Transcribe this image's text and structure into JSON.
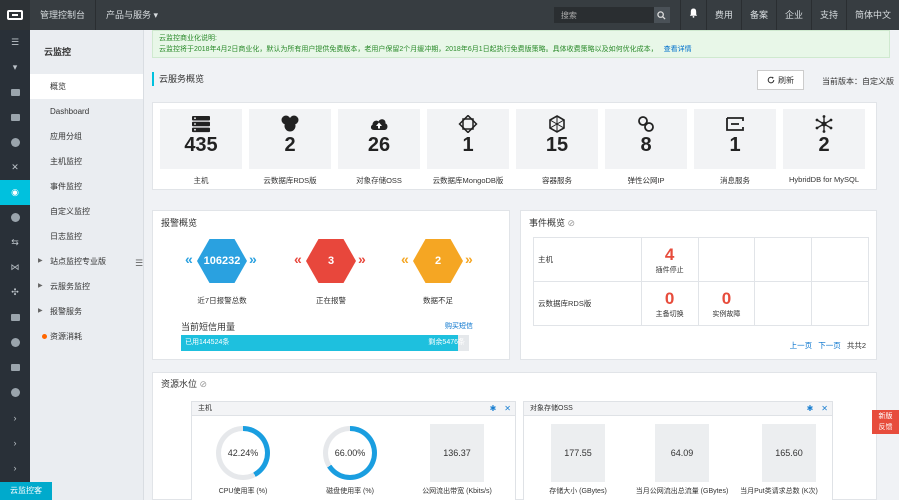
{
  "topbar": {
    "console": "管理控制台",
    "products": "产品与服务 ▾",
    "search_placeholder": "搜索",
    "right_items": [
      "费用",
      "备案",
      "企业",
      "支持",
      "简体中文"
    ]
  },
  "sidebar": {
    "title": "云监控",
    "items": [
      "概览",
      "Dashboard",
      "应用分组",
      "主机监控",
      "事件监控",
      "自定义监控",
      "日志监控",
      "站点监控专业版",
      "云服务监控",
      "报警服务",
      "资源消耗"
    ]
  },
  "notice": {
    "title": "云监控商业化说明:",
    "body": "云监控将于2018年4月2日商业化，默认为所有用户提供免费版本，老用户保留2个月缓冲期，2018年6月1日起执行免费版策略。具体收费策略以及如何优化成本，",
    "link": "查看详情"
  },
  "overview": {
    "title": "云服务概览",
    "refresh": "刷新",
    "version": "当前版本：自定义版"
  },
  "services": [
    {
      "icon": "server-icon",
      "count": "435",
      "label": "主机"
    },
    {
      "icon": "database-icon",
      "count": "2",
      "label": "云数据库RDS版"
    },
    {
      "icon": "cloud-upload-icon",
      "count": "26",
      "label": "对象存储OSS"
    },
    {
      "icon": "mongodb-icon",
      "count": "1",
      "label": "云数据库MongoDB版"
    },
    {
      "icon": "container-icon",
      "count": "15",
      "label": "容器服务"
    },
    {
      "icon": "elastic-ip-icon",
      "count": "8",
      "label": "弹性公网IP"
    },
    {
      "icon": "message-icon",
      "count": "1",
      "label": "消息服务"
    },
    {
      "icon": "hybriddb-icon",
      "count": "2",
      "label": "HybridDB for MySQL"
    }
  ],
  "alarm": {
    "title": "报警概览",
    "items": [
      {
        "value": "106232",
        "label": "近7日报警总数",
        "color": "#2aa1e0"
      },
      {
        "value": "3",
        "label": "正在报警",
        "color": "#e8473c"
      },
      {
        "value": "2",
        "label": "数据不足",
        "color": "#f5a623"
      }
    ],
    "sms_title": "当前短信用量",
    "sms_link": "购买短信",
    "sms_used": "已用144524条",
    "sms_left": "剩余5476条",
    "sms_used_fraction": 0.963
  },
  "events": {
    "title": "事件概览",
    "rows": [
      {
        "label": "主机",
        "cells": [
          {
            "num": "4",
            "sub": "插件停止"
          },
          null,
          null,
          null
        ]
      },
      {
        "label": "云数据库RDS版",
        "cells": [
          {
            "num": "0",
            "sub": "主备切换"
          },
          {
            "num": "0",
            "sub": "实例故障"
          },
          null,
          null
        ]
      }
    ],
    "prev": "上一页",
    "next": "下一页",
    "total": "共共2"
  },
  "resource": {
    "title": "资源水位",
    "host": {
      "title": "主机",
      "cpu": {
        "value": "42.24%",
        "fraction": 0.4224,
        "label": "CPU使用率 (%)"
      },
      "disk": {
        "value": "66.00%",
        "fraction": 0.66,
        "label": "磁盘使用率 (%)"
      },
      "bandwidth": {
        "value": "136.37",
        "label": "公网流出带宽 (Kbits/s)"
      }
    },
    "oss": {
      "title": "对象存储OSS",
      "storage": {
        "value": "177.55",
        "label": "存储大小 (GBytes)"
      },
      "traffic": {
        "value": "64.09",
        "label": "当月公网流出总流量 (GBytes)"
      },
      "put": {
        "value": "165.60",
        "label": "当月Put类请求总数 (K次)"
      }
    }
  },
  "floating": {
    "new_line1": "新版",
    "new_line2": "反馈",
    "bottom": "云监控客"
  },
  "colors": {
    "accent": "#00c1de",
    "ring": "#1a9ee0",
    "danger": "#e74c3c"
  }
}
